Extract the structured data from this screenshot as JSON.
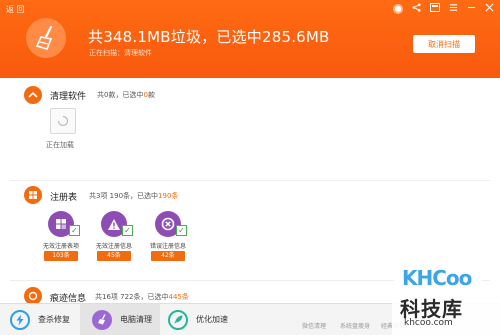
{
  "header": {
    "back_label": "返 回",
    "headline": "共348.1MB垃圾，已选中285.6MB",
    "status_prefix": "正在扫描：",
    "status_target": "清理软件",
    "cancel_button": "取消扫描",
    "colors": {
      "accent": "#f26b0f",
      "header_bg": "#fb630f"
    }
  },
  "sections": {
    "software": {
      "title": "清理软件",
      "stat_prefix": "共0款，已选中",
      "stat_highlight": "0",
      "stat_suffix": "款",
      "loading_label": "正在加载"
    },
    "registry": {
      "title": "注册表",
      "stat_prefix": "共3项 190条，已选中",
      "stat_highlight": "190条",
      "items": [
        {
          "label": "无效注册表项",
          "badge": "103条",
          "icon": "grid-icon"
        },
        {
          "label": "无效注册信息",
          "badge": "45条",
          "icon": "warning-icon"
        },
        {
          "label": "错误注册信息",
          "badge": "42条",
          "icon": "error-icon"
        }
      ]
    },
    "traces": {
      "title": "痕迹信息",
      "stat_prefix": "共16项 722条，已选中",
      "stat_highlight": "445条"
    }
  },
  "bottom_nav": {
    "items": [
      {
        "label": "查杀修复",
        "icon": "shield-lightning-icon"
      },
      {
        "label": "电脑清理",
        "icon": "broom-icon"
      },
      {
        "label": "优化加速",
        "icon": "rocket-icon"
      }
    ],
    "footer_links": [
      "微信清理",
      "系统盘瘦身",
      "经典版清理"
    ]
  },
  "watermark": {
    "logo_text": "KHCoo",
    "cn_text": "科技库",
    "url": "khcoo.com"
  }
}
